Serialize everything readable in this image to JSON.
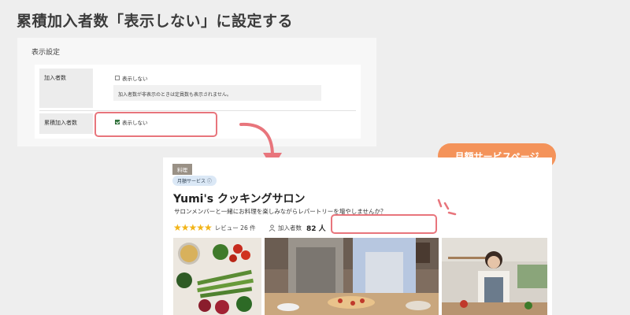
{
  "heading": "累積加入者数「表示しない」に設定する",
  "settings": {
    "title": "表示設定",
    "rows": [
      {
        "label": "加入者数",
        "checkbox_label": "表示しない",
        "checked": false,
        "note": "加入者数が非表示のときは定員数も表示されません。"
      },
      {
        "label": "累積加入者数",
        "checkbox_label": "表示しない",
        "checked": true
      }
    ]
  },
  "badge": "月額サービスページ",
  "card": {
    "category": "料理",
    "service_tag": "月額サービス ⓘ",
    "title": "Yumi's クッキングサロン",
    "description": "サロンメンバーと一緒にお料理を楽しみながらレパートリーを増やしませんか？",
    "stars": "★★★★★",
    "review_text": "レビュー 26 件",
    "members_label": "加入者数",
    "members_count": "82 人"
  },
  "colors": {
    "highlight": "#e8757c",
    "badge": "#f4935a",
    "star": "#f2b418"
  }
}
